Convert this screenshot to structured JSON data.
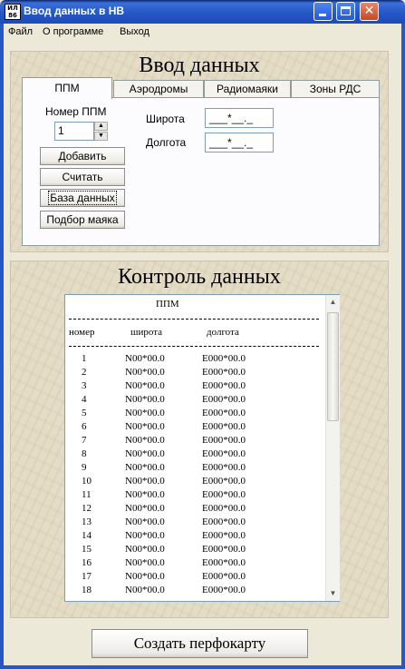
{
  "window": {
    "title": "Ввод данных в НВ",
    "app_icon_text": "ИЛ 86"
  },
  "menu": [
    {
      "label": "Файл"
    },
    {
      "label": "О программе"
    },
    {
      "label": "Выход"
    }
  ],
  "input_panel": {
    "title": "Ввод данных",
    "tabs": [
      {
        "label": "ППМ",
        "active": true
      },
      {
        "label": "Аэродромы"
      },
      {
        "label": "Радиомаяки"
      },
      {
        "label": "Зоны РДС"
      }
    ],
    "ppm_number_label": "Номер ППМ",
    "ppm_number_value": "1",
    "buttons": {
      "add": "Добавить",
      "read": "Считать",
      "database": "База данных",
      "beacon_select": "Подбор маяка"
    },
    "latitude_label": "Широта",
    "latitude_mask": "___*__._",
    "longitude_label": "Долгота",
    "longitude_mask": "___*__._"
  },
  "control_panel": {
    "title": "Контроль данных",
    "report_title": "ППМ",
    "headers": {
      "num": "номер",
      "lat": "широта",
      "lon": "долгота"
    },
    "rows": [
      {
        "num": "1",
        "lat": "N00*00.0",
        "lon": "E000*00.0"
      },
      {
        "num": "2",
        "lat": "N00*00.0",
        "lon": "E000*00.0"
      },
      {
        "num": "3",
        "lat": "N00*00.0",
        "lon": "E000*00.0"
      },
      {
        "num": "4",
        "lat": "N00*00.0",
        "lon": "E000*00.0"
      },
      {
        "num": "5",
        "lat": "N00*00.0",
        "lon": "E000*00.0"
      },
      {
        "num": "6",
        "lat": "N00*00.0",
        "lon": "E000*00.0"
      },
      {
        "num": "7",
        "lat": "N00*00.0",
        "lon": "E000*00.0"
      },
      {
        "num": "8",
        "lat": "N00*00.0",
        "lon": "E000*00.0"
      },
      {
        "num": "9",
        "lat": "N00*00.0",
        "lon": "E000*00.0"
      },
      {
        "num": "10",
        "lat": "N00*00.0",
        "lon": "E000*00.0"
      },
      {
        "num": "11",
        "lat": "N00*00.0",
        "lon": "E000*00.0"
      },
      {
        "num": "12",
        "lat": "N00*00.0",
        "lon": "E000*00.0"
      },
      {
        "num": "13",
        "lat": "N00*00.0",
        "lon": "E000*00.0"
      },
      {
        "num": "14",
        "lat": "N00*00.0",
        "lon": "E000*00.0"
      },
      {
        "num": "15",
        "lat": "N00*00.0",
        "lon": "E000*00.0"
      },
      {
        "num": "16",
        "lat": "N00*00.0",
        "lon": "E000*00.0"
      },
      {
        "num": "17",
        "lat": "N00*00.0",
        "lon": "E000*00.0"
      },
      {
        "num": "18",
        "lat": "N00*00.0",
        "lon": "E000*00.0"
      }
    ]
  },
  "create_button": "Создать перфокарту",
  "colors": {
    "titlebar": "#2657c6",
    "panel_background": "#e5dcc6",
    "tab_page": "#fcfcfe"
  }
}
